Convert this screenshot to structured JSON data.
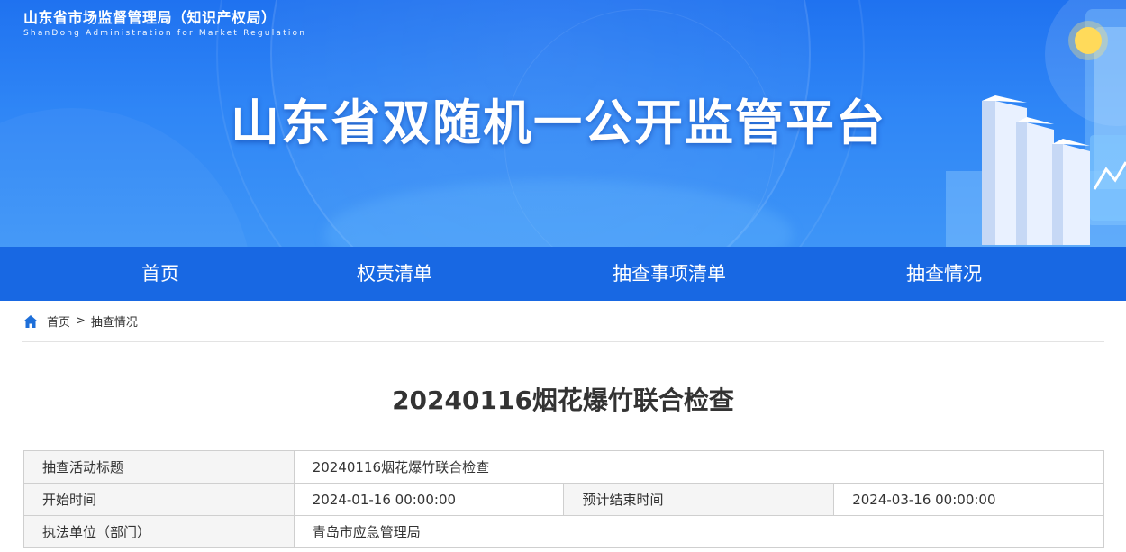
{
  "header": {
    "org_name": "山东省市场监督管理局（知识产权局）",
    "org_name_en": "ShanDong Administration for Market Regulation",
    "platform_title": "山东省双随机一公开监管平台"
  },
  "nav": {
    "items": [
      {
        "label": "首页"
      },
      {
        "label": "权责清单"
      },
      {
        "label": "抽查事项清单"
      },
      {
        "label": "抽查情况"
      }
    ]
  },
  "breadcrumb": {
    "home": "首页",
    "separator": ">",
    "current": "抽查情况"
  },
  "detail": {
    "title": "20240116烟花爆竹联合检查",
    "rows": {
      "activity_label": "抽查活动标题",
      "activity_value": "20240116烟花爆竹联合检查",
      "start_label": "开始时间",
      "start_value": "2024-01-16 00:00:00",
      "end_label": "预计结束时间",
      "end_value": "2024-03-16 00:00:00",
      "unit_label": "执法单位（部门）",
      "unit_value": "青岛市应急管理局"
    }
  },
  "colors": {
    "banner": "#2f86f6",
    "nav": "#1868e3",
    "label_bg": "#f5f5f5",
    "icon": "#1e6fd9"
  },
  "icons": {
    "breadcrumb_home": "home-icon"
  }
}
